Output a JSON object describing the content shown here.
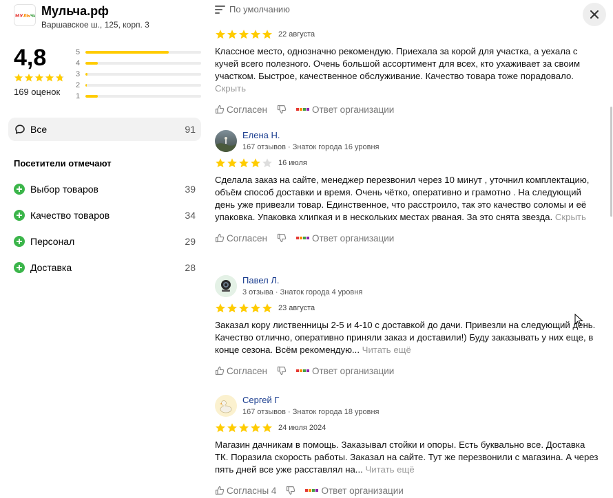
{
  "org": {
    "logo_text": "МУЛЬЧА.РФ",
    "name": "Мульча.рф",
    "address": "Варшавское ш., 125, корп. 3"
  },
  "rating": {
    "value": "4,8",
    "stars": 4.8,
    "count_label": "169 оценок",
    "bars": [
      {
        "label": "5",
        "fraction": 0.72
      },
      {
        "label": "4",
        "fraction": 0.11
      },
      {
        "label": "3",
        "fraction": 0.02
      },
      {
        "label": "2",
        "fraction": 0.01
      },
      {
        "label": "1",
        "fraction": 0.11
      }
    ]
  },
  "filters": {
    "all_label": "Все",
    "all_count": "91",
    "visitors_title": "Посетители отмечают",
    "tags": [
      {
        "label": "Выбор товаров",
        "count": "39"
      },
      {
        "label": "Качество товаров",
        "count": "34"
      },
      {
        "label": "Персонал",
        "count": "29"
      },
      {
        "label": "Доставка",
        "count": "28"
      }
    ]
  },
  "sort": {
    "label": "По умолчанию"
  },
  "actions": {
    "agree": "Согласен",
    "agree_4": "Согласны 4",
    "reply": "Ответ организации"
  },
  "reviews": [
    {
      "stars": 5,
      "date": "22 августа",
      "text": "Классное место, однозначно рекомендую. Приехала за корой для участка, а уехала с кучей всего полезного. Очень большой ассортимент для всех, кто ухаживает за своим участком. Быстрое, качественное обслуживание. Качество товара тоже порадовало.",
      "more": "Скрыть"
    },
    {
      "name": "Елена Н.",
      "sub": "167 отзывов · Знаток города 16 уровня",
      "stars": 4,
      "date": "16 июля",
      "text": "Сделала заказ на сайте, менеджер перезвонил через 10 минут , уточнил комплектацию, объём способ доставки и время. Очень чётко, оперативно и грамотно . На следующий день уже привезли товар. Единственное, что расстроило, так это качество соломы и её упаковка. Упаковка хлипкая и в нескольких местах рваная. За это снята звезда.",
      "more": "Скрыть"
    },
    {
      "name": "Павел Л.",
      "sub": "3 отзыва · Знаток города 4 уровня",
      "stars": 5,
      "date": "23 августа",
      "text": "Заказал кору лиственницы 2-5 и 4-10 с доставкой до дачи. Привезли на следующий день. Качество отлично, оперативно приняли заказ и доставили!) Буду заказывать у них еще, в конце сезона. Всём рекомендую...",
      "more": "Читать ещё"
    },
    {
      "name": "Сергей Г",
      "sub": "167 отзывов · Знаток города 18 уровня",
      "stars": 5,
      "date": "24 июля 2024",
      "text": "Магазин дачникам в помощь. Заказывал стойки и опоры. Есть буквально все. Доставка ТК. Поразила скорость работы. Заказал на сайте. Тут же перезвонили с магазина. А через пять дней все уже расставлял на...",
      "more": "Читать ещё"
    }
  ],
  "colors": {
    "star": "#ffcc00",
    "star_empty": "#dddddd",
    "bar_fill": "#ffcc00",
    "plus_green": "#3bb54a",
    "link_blue": "#1a3d8f"
  }
}
